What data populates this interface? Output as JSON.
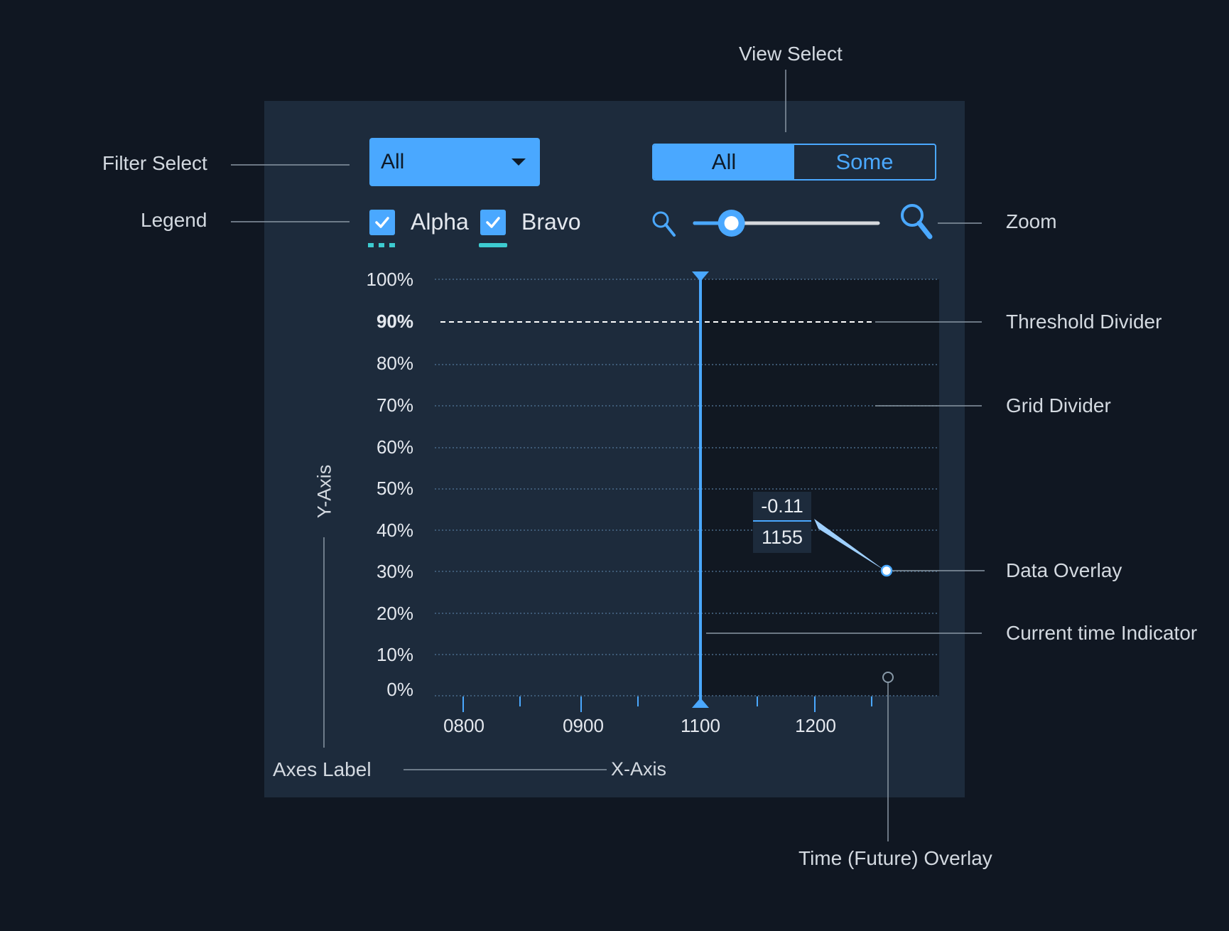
{
  "callouts": {
    "filter_select": "Filter Select",
    "legend": "Legend",
    "view_select": "View Select",
    "zoom": "Zoom",
    "threshold_divider": "Threshold Divider",
    "grid_divider": "Grid Divider",
    "data_overlay": "Data Overlay",
    "current_time_indicator": "Current time Indicator",
    "time_future_overlay": "Time (Future)  Overlay",
    "axes_label": "Axes Label"
  },
  "filter": {
    "selected": "All",
    "icon": "chevron-down-icon"
  },
  "view_select": {
    "options": [
      "All",
      "Some"
    ],
    "active": "All"
  },
  "legend": {
    "items": [
      {
        "label": "Alpha",
        "checked": true,
        "style": "dotted",
        "color": "#3dcbd0"
      },
      {
        "label": "Bravo",
        "checked": true,
        "style": "solid",
        "color": "#3dcbd0"
      }
    ]
  },
  "zoom": {
    "level": 0.2,
    "min_icon": "zoom-out-icon",
    "max_icon": "zoom-in-icon"
  },
  "axes": {
    "y_title": "Y-Axis",
    "x_title": "X-Axis"
  },
  "chart_data": {
    "type": "line",
    "y_ticks": [
      "100%",
      "90%",
      "80%",
      "70%",
      "60%",
      "50%",
      "40%",
      "30%",
      "20%",
      "10%",
      "0%"
    ],
    "x_ticks": [
      "0800",
      "0900",
      "1100",
      "1200"
    ],
    "threshold": {
      "label": "90%",
      "value": 90
    },
    "current_time": 1100,
    "future_overlay_start": 1100,
    "data_point": {
      "x": 1155,
      "y": 30,
      "value": "-0.11",
      "time": "1155"
    },
    "grid": true
  },
  "colors": {
    "background": "#101722",
    "panel": "#1d2b3c",
    "future_overlay": "#111822",
    "accent": "#4aa8ff",
    "legend": "#3dcbd0"
  }
}
